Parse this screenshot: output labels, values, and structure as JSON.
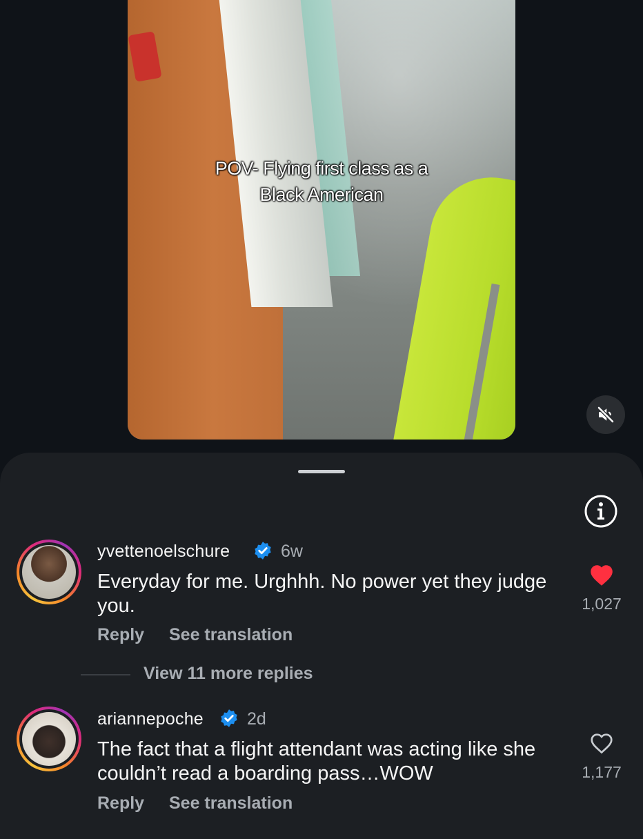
{
  "video": {
    "caption_line1": "POV- Flying first class as a",
    "caption_line2": "Black American",
    "mute_icon": "speaker-muted-icon"
  },
  "sheet": {
    "info_icon": "info-icon"
  },
  "comments": [
    {
      "username": "yvettenoelschure",
      "verified": true,
      "age": "6w",
      "text": "Everyday for me.  Urghhh. No power yet they judge you.",
      "reply_label": "Reply",
      "translate_label": "See translation",
      "liked": true,
      "like_count": "1,027",
      "view_replies_label": "View 11 more replies"
    },
    {
      "username": "ariannepoche",
      "verified": true,
      "age": "2d",
      "text": "The fact that a flight attendant was acting like she couldn’t read a boarding pass…WOW",
      "reply_label": "Reply",
      "translate_label": "See translation",
      "liked": false,
      "like_count": "1,177"
    }
  ],
  "colors": {
    "background": "#0f1318",
    "sheet": "#1c1f23",
    "verified_blue": "#1d8ff0",
    "like_red": "#ff3040",
    "muted_text": "#a8adb3"
  }
}
